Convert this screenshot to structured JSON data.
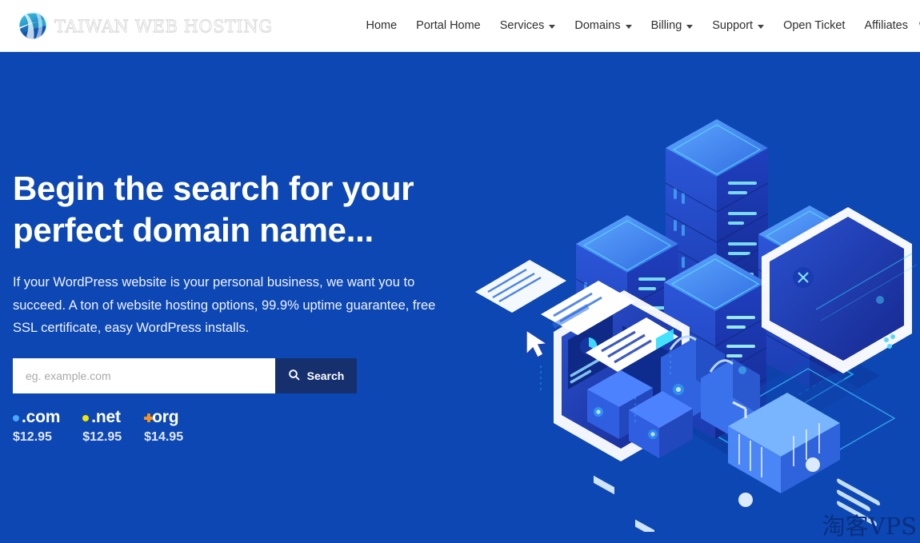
{
  "brand": {
    "name": "TAIWAN WEB HOSTING",
    "logo_icon": "globe-swirl-logo"
  },
  "nav": {
    "items": [
      {
        "label": "Home",
        "has_dropdown": false
      },
      {
        "label": "Portal Home",
        "has_dropdown": false
      },
      {
        "label": "Services",
        "has_dropdown": true
      },
      {
        "label": "Domains",
        "has_dropdown": true
      },
      {
        "label": "Billing",
        "has_dropdown": true
      },
      {
        "label": "Support",
        "has_dropdown": true
      },
      {
        "label": "Open Ticket",
        "has_dropdown": false
      },
      {
        "label": "Affiliates",
        "has_dropdown": false
      }
    ],
    "icons": [
      {
        "name": "shopping-cart-icon",
        "badge": false
      },
      {
        "name": "notification-bell-icon",
        "badge": true
      },
      {
        "name": "user-account-icon",
        "badge": false
      }
    ]
  },
  "hero": {
    "title": "Begin the search for your perfect domain name...",
    "subtitle": "If your WordPress website is your personal business, we want you to succeed. A ton of website hosting options, 99.9% uptime guarantee, free SSL certificate, easy WordPress installs.",
    "background_color": "#0d47b3",
    "search": {
      "placeholder": "eg. example.com",
      "value": "",
      "button_label": "Search",
      "button_icon": "search-icon",
      "button_color": "#16306e"
    },
    "tlds": [
      {
        "name": "com",
        "prefix": ".",
        "price": "$12.95",
        "mark_color": "#4aa8ff",
        "mark_style": "dot"
      },
      {
        "name": "net",
        "prefix": ".",
        "price": "$12.95",
        "mark_color": "#f2e600",
        "mark_style": "dot"
      },
      {
        "name": "org",
        "prefix": "",
        "price": "$14.95",
        "mark_color": "#f4941e",
        "mark_style": "plus"
      }
    ],
    "illustration": "isometric-server-racks-ecommerce-illustration"
  },
  "watermark": {
    "text": "淘客VPS",
    "color": "#0a2f80"
  }
}
